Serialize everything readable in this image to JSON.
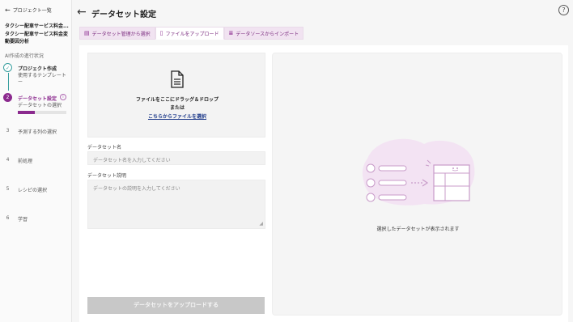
{
  "sidebar": {
    "back_label": "プロジェクト一覧",
    "project_name_1": "タクシー配車サービス料金...",
    "project_name_2": "タクシー配車サービス料金変動要因分析",
    "progress_heading": "AI作成の進行状況",
    "steps": [
      {
        "num": "✓",
        "title": "プロジェクト作成",
        "sub": "使用するテンプレート"
      },
      {
        "num": "2",
        "title": "データセット設定",
        "sub": "データセットの選択"
      },
      {
        "num": "3",
        "title": "予測する列の選択"
      },
      {
        "num": "4",
        "title": "前処理"
      },
      {
        "num": "5",
        "title": "レシピの選択"
      },
      {
        "num": "6",
        "title": "学習"
      }
    ],
    "step2_progress": 0.35
  },
  "header": {
    "title": "データセット設定",
    "help": "?"
  },
  "tabs": [
    {
      "label": "データセット管理から選択",
      "icon": "dataset-icon"
    },
    {
      "label": "ファイルをアップロード",
      "icon": "file-icon"
    },
    {
      "label": "データソースからインポート",
      "icon": "database-icon"
    }
  ],
  "dropzone": {
    "text": "ファイルをここにドラッグ＆ドロップ",
    "or": "または",
    "link": "こちらからファイルを選択"
  },
  "form": {
    "name_label": "データセット名",
    "name_placeholder": "データセット名を入力してください",
    "desc_label": "データセット説明",
    "desc_placeholder": "データセットの説明を入力してください",
    "upload_button": "データセットをアップロードする"
  },
  "preview": {
    "text": "選択したデータセットが表示されます"
  },
  "colors": {
    "accent": "#8b2a8e",
    "done": "#3aa0a0",
    "tab_bg": "#f1e3f1"
  }
}
